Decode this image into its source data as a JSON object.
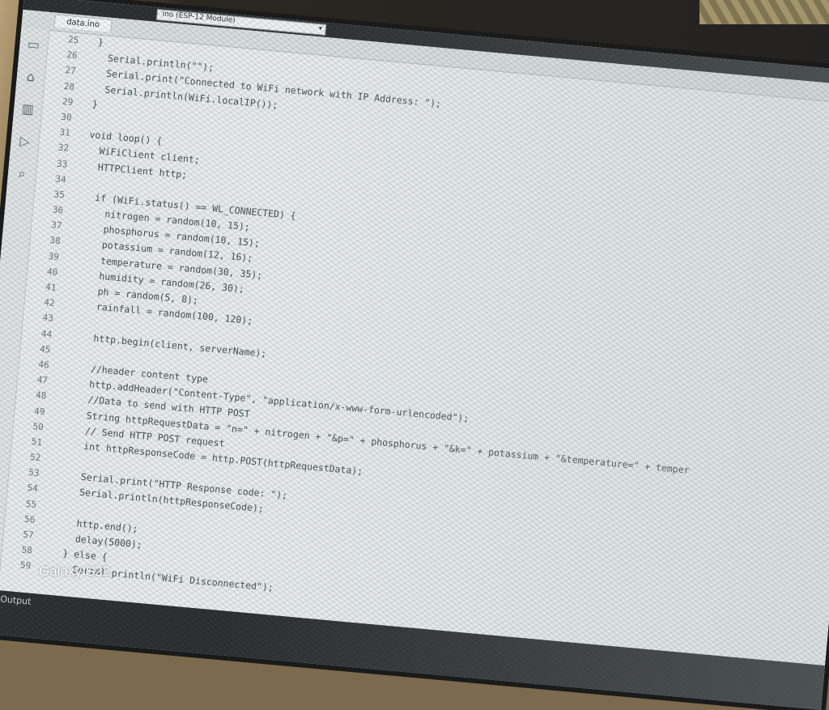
{
  "toolbar": {
    "board": "ino (ESP-12 Module)"
  },
  "tab": {
    "file": "data.ino"
  },
  "sidebar": {
    "icons": [
      "folder-icon",
      "boards-icon",
      "library-icon",
      "debug-icon",
      "search-icon"
    ]
  },
  "gutter": {
    "lines": [
      "25",
      "26",
      "27",
      "28",
      "29",
      "30",
      "31",
      "32",
      "33",
      "34",
      "35",
      "36",
      "37",
      "38",
      "39",
      "40",
      "41",
      "42",
      "43",
      "44",
      "45",
      "46",
      "47",
      "48",
      "49",
      "50",
      "51",
      "52",
      "53",
      "54",
      "55",
      "56",
      "57",
      "58",
      "59"
    ]
  },
  "code": {
    "l25": "  }",
    "l26": "    Serial.println(\"\");",
    "l27": "    Serial.print(\"Connected to WiFi network with IP Address: \");",
    "l28": "    Serial.println(WiFi.localIP());",
    "l29": "  }",
    "l30": "",
    "l31": "  void loop() {",
    "l32": "    WiFiClient client;",
    "l33": "    HTTPClient http;",
    "l34": "",
    "l35": "    if (WiFi.status() == WL_CONNECTED) {",
    "l36": "      nitrogen = random(10, 15);",
    "l37": "      phosphorus = random(10, 15);",
    "l38": "      potassium = random(12, 16);",
    "l39": "      temperature = random(30, 35);",
    "l40": "      humidity = random(26, 30);",
    "l41": "      ph = random(5, 8);",
    "l42": "      rainfall = random(100, 120);",
    "l43": "",
    "l44": "      http.begin(client, serverName);",
    "l45": "",
    "l46": "      //header content type",
    "l47": "      http.addHeader(\"Content-Type\", \"application/x-www-form-urlencoded\");",
    "l48": "      //Data to send with HTTP POST",
    "l49": "      String httpRequestData = \"n=\" + nitrogen + \"&p=\" + phosphorus + \"&k=\" + potassium + \"&temperature=\" + temper",
    "l50": "      // Send HTTP POST request",
    "l51": "      int httpResponseCode = http.POST(httpRequestData);",
    "l52": "",
    "l53": "      Serial.print(\"HTTP Response code: \");",
    "l54": "      Serial.println(httpResponseCode);",
    "l55": "",
    "l56": "      http.end();",
    "l57": "      delay(5000);",
    "l58": "    } else {",
    "l59": "      Serial.println(\"WiFi Disconnected\");"
  },
  "output": {
    "label": "Output"
  },
  "watermark": "Galaxy S22"
}
